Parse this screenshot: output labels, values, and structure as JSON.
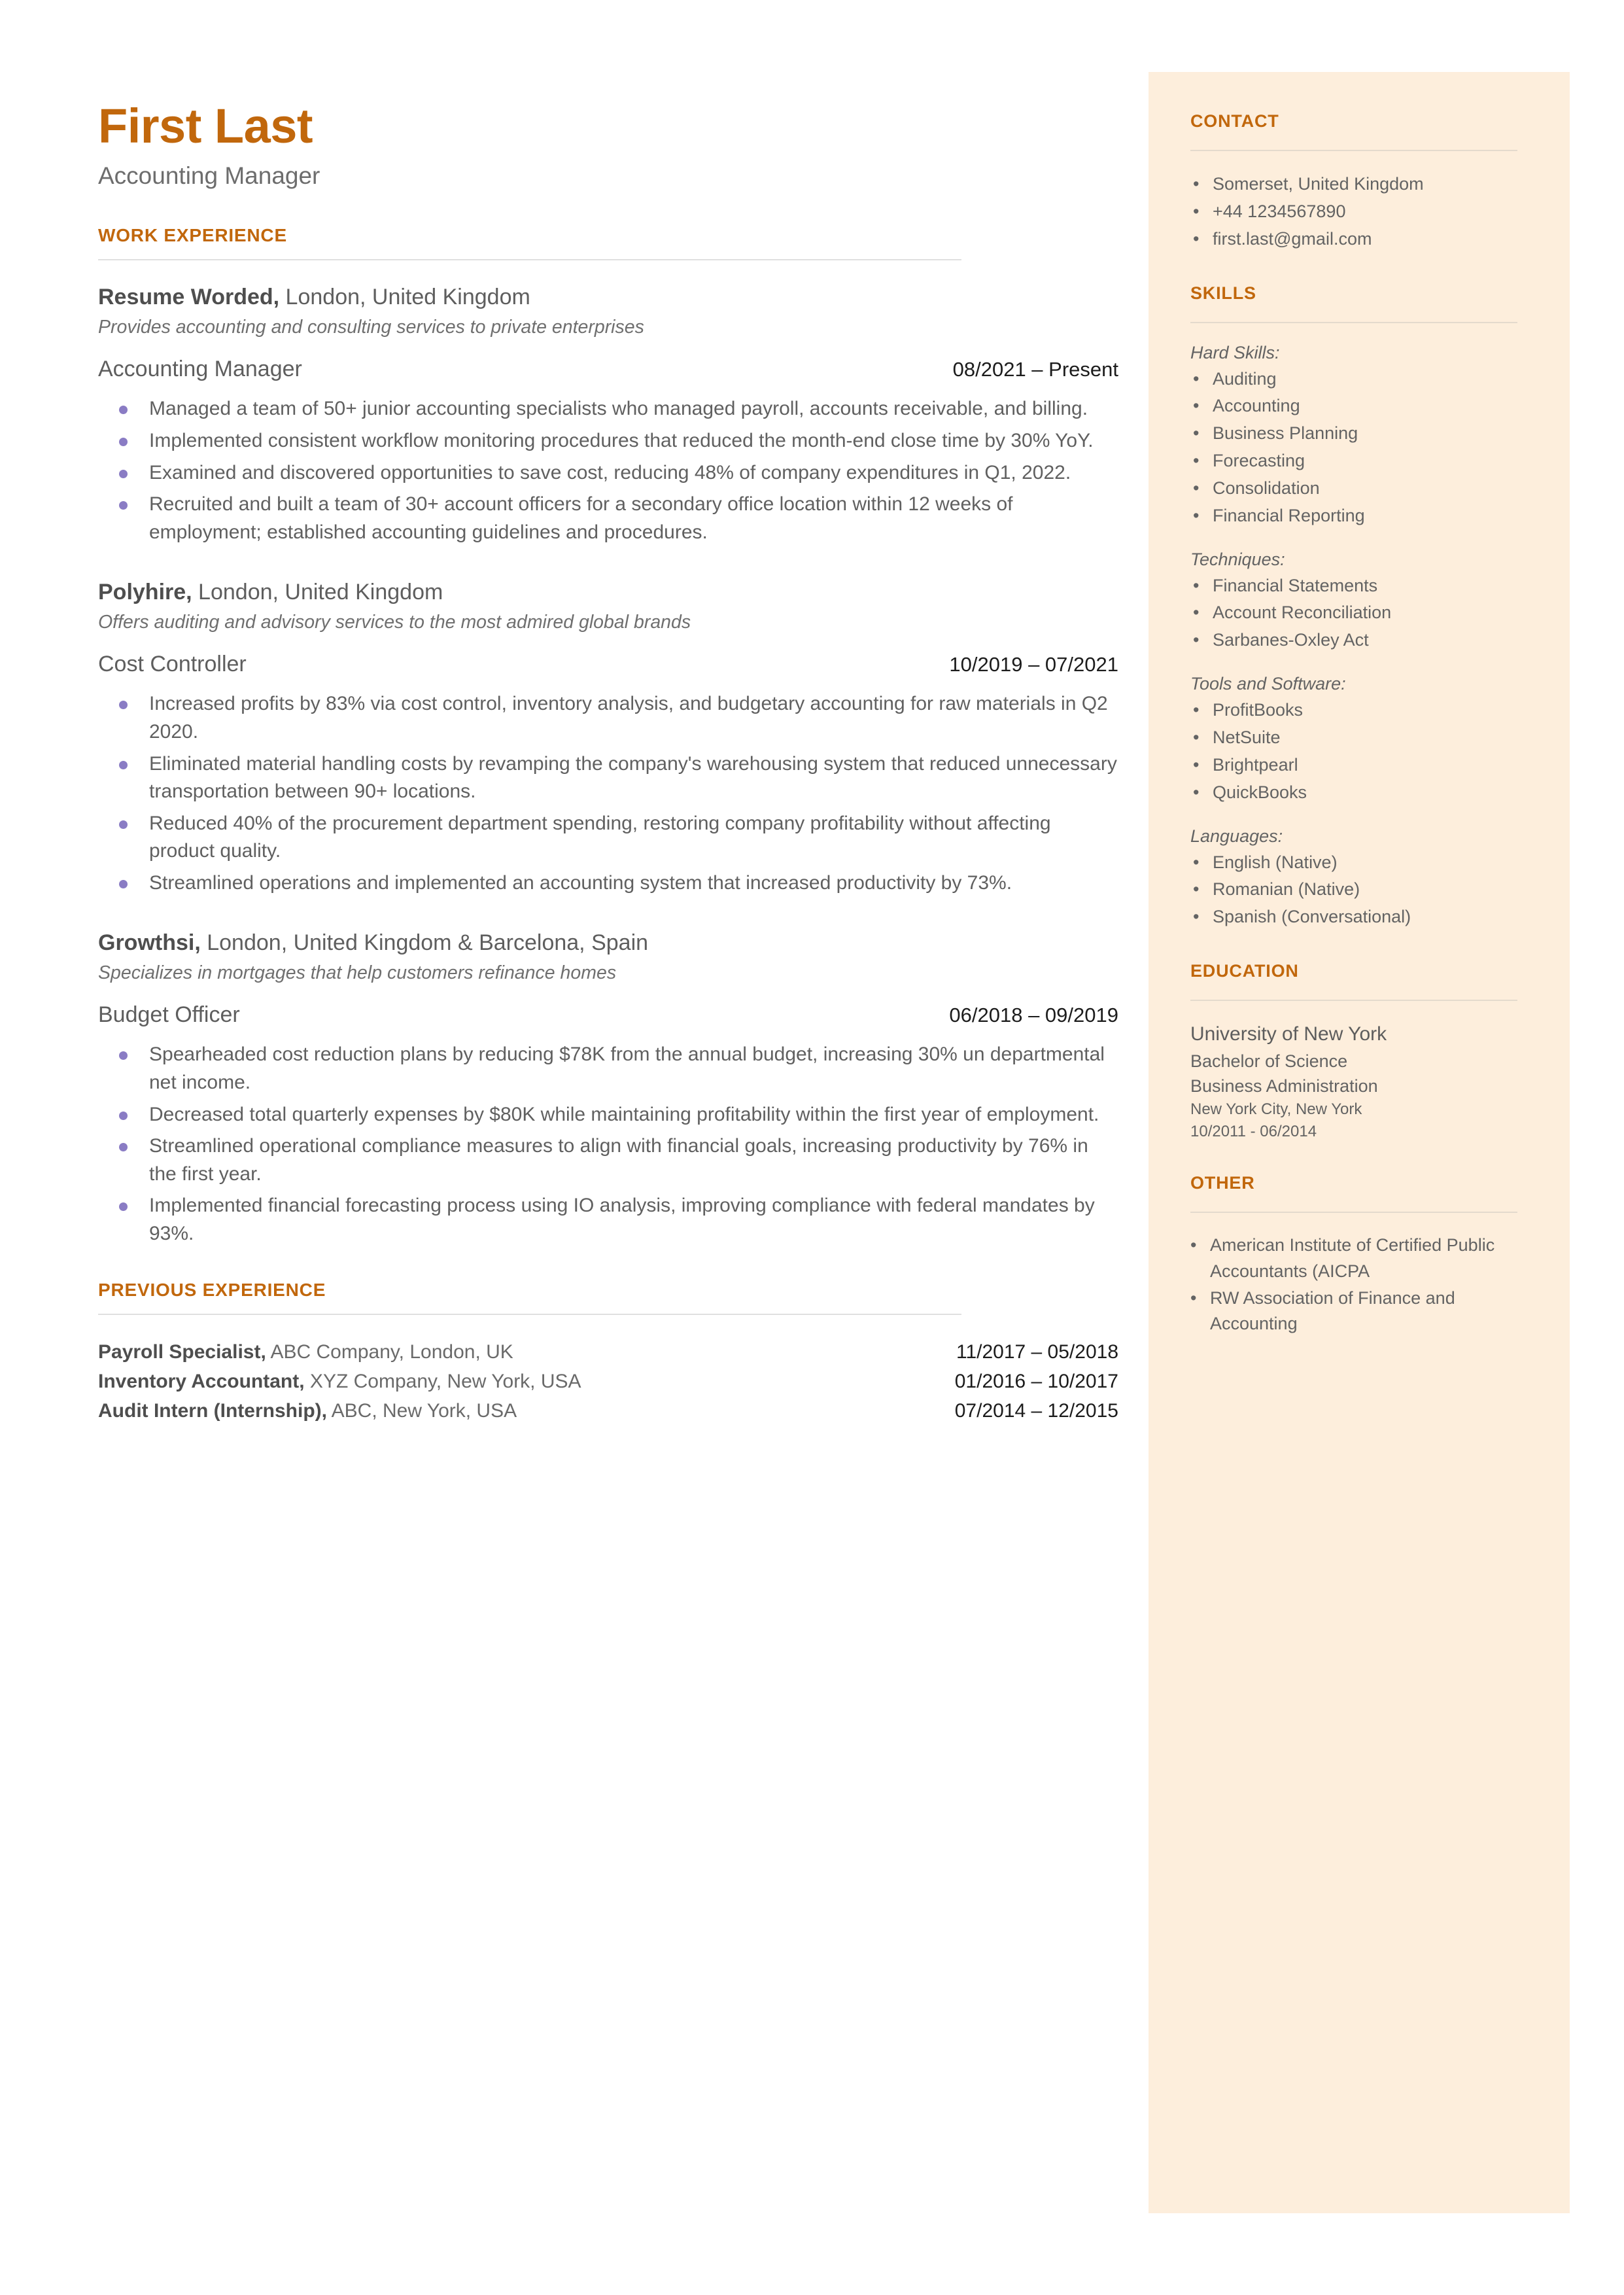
{
  "header": {
    "name": "First Last",
    "title": "Accounting Manager"
  },
  "work_experience": {
    "section_label": "WORK EXPERIENCE",
    "entries": [
      {
        "company": "Resume Worded,",
        "location": " London, United Kingdom",
        "description": "Provides accounting and consulting services to private enterprises",
        "role": "Accounting Manager",
        "dates": "08/2021 – Present",
        "bullets": [
          "Managed a team of 50+ junior accounting specialists who managed payroll, accounts receivable, and billing.",
          "Implemented consistent workflow monitoring procedures that reduced the month-end close time by 30% YoY.",
          "Examined and discovered opportunities to save cost, reducing 48% of company expenditures in Q1, 2022.",
          "Recruited and built a team of 30+ account officers for a secondary office location within 12 weeks of employment; established accounting guidelines and procedures."
        ]
      },
      {
        "company": "Polyhire,",
        "location": " London, United Kingdom",
        "description": "Offers auditing and advisory services to the most admired global brands",
        "role": "Cost Controller",
        "dates": "10/2019 – 07/2021",
        "bullets": [
          "Increased profits by 83% via cost control, inventory analysis, and budgetary accounting for raw materials in Q2 2020.",
          "Eliminated material handling costs by revamping the company's warehousing system that reduced unnecessary transportation between 90+ locations.",
          "Reduced 40% of the procurement department spending, restoring company profitability without affecting product quality.",
          "Streamlined operations and implemented an accounting system that increased productivity by 73%."
        ]
      },
      {
        "company": "Growthsi,",
        "location": " London, United Kingdom & Barcelona, Spain",
        "description": "Specializes in mortgages that help customers refinance homes",
        "role": "Budget Officer",
        "dates": "06/2018 – 09/2019",
        "bullets": [
          "Spearheaded cost reduction plans by reducing $78K from the annual budget, increasing 30% un departmental net income.",
          "Decreased total quarterly expenses by $80K while maintaining profitability within the first year of employment.",
          "Streamlined operational compliance measures to align with financial goals, increasing productivity by 76% in the first year.",
          "Implemented financial forecasting process using IO analysis, improving compliance with federal mandates by 93%."
        ]
      }
    ]
  },
  "previous_experience": {
    "section_label": "PREVIOUS EXPERIENCE",
    "rows": [
      {
        "title": "Payroll Specialist,",
        "detail": " ABC Company, London, UK",
        "dates": "11/2017 – 05/2018"
      },
      {
        "title": "Inventory Accountant,",
        "detail": " XYZ Company, New York, USA",
        "dates": "01/2016 – 10/2017"
      },
      {
        "title": "Audit Intern (Internship),",
        "detail": " ABC, New York, USA",
        "dates": "07/2014 – 12/2015"
      }
    ]
  },
  "contact": {
    "section_label": "CONTACT",
    "items": [
      "Somerset, United Kingdom",
      "+44 1234567890",
      "first.last@gmail.com"
    ]
  },
  "skills": {
    "section_label": "SKILLS",
    "groups": [
      {
        "label": "Hard Skills:",
        "items": [
          "Auditing",
          "Accounting",
          "Business Planning",
          "Forecasting",
          "Consolidation",
          "Financial Reporting"
        ]
      },
      {
        "label": "Techniques:",
        "items": [
          "Financial Statements",
          "Account Reconciliation",
          "Sarbanes-Oxley Act"
        ]
      },
      {
        "label": "Tools and Software:",
        "items": [
          "ProfitBooks",
          "NetSuite",
          "Brightpearl",
          "QuickBooks"
        ]
      },
      {
        "label": "Languages:",
        "items": [
          "English (Native)",
          "Romanian (Native)",
          "Spanish (Conversational)"
        ]
      }
    ]
  },
  "education": {
    "section_label": "EDUCATION",
    "school": "University of New York",
    "degree": "Bachelor of Science",
    "field": "Business Administration",
    "location": "New York City, New York",
    "dates": "10/2011 - 06/2014"
  },
  "other": {
    "section_label": "OTHER",
    "items": [
      "American Institute of Certified Public Accountants (AICPA",
      "RW Association of Finance and Accounting"
    ]
  },
  "bullet_glyph": "•",
  "colors": {
    "accent": "#c1670c",
    "sidebar_bg": "#fdeedc",
    "bullet_purple": "#8a7cc4",
    "body_text": "#606060"
  }
}
